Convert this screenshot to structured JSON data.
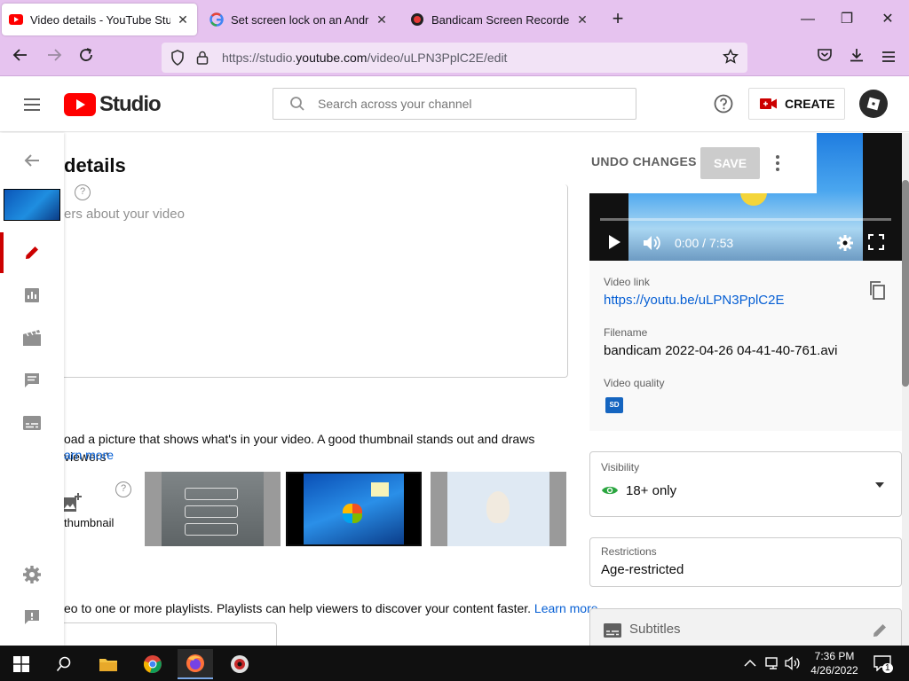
{
  "browser": {
    "tabs": [
      {
        "title": "Video details - YouTube Studio",
        "active": true
      },
      {
        "title": "Set screen lock on an Android d",
        "active": false
      },
      {
        "title": "Bandicam Screen Recorder Dow",
        "active": false
      }
    ],
    "url_prefix": "https://studio.",
    "url_domain": "youtube.com",
    "url_path": "/video/uLPN3PplC2E/edit"
  },
  "studio": {
    "logo_text": "Studio",
    "search_placeholder": "Search across your channel",
    "create_label": "CREATE"
  },
  "editor": {
    "page_title": "details",
    "undo_label": "UNDO CHANGES",
    "save_label": "SAVE",
    "description_placeholder": "ers about your video",
    "thumbnail_text": "oad a picture that shows what's in your video. A good thumbnail stands out and draws viewers'",
    "thumbnail_learn_more": "arn more",
    "upload_label": "thumbnail",
    "playlist_text": "eo to one or more playlists. Playlists can help viewers to discover your content faster.",
    "playlist_learn_more": "Learn more"
  },
  "video_panel": {
    "time": "0:00 / 7:53",
    "video_link_label": "Video link",
    "video_link": "https://youtu.be/uLPN3PplC2E",
    "filename_label": "Filename",
    "filename": "bandicam 2022-04-26 04-41-40-761.avi",
    "quality_label": "Video quality",
    "quality_badge": "SD"
  },
  "visibility": {
    "label": "Visibility",
    "value": "18+ only"
  },
  "restrictions": {
    "label": "Restrictions",
    "value": "Age-restricted"
  },
  "subtitles": {
    "label": "Subtitles"
  },
  "taskbar": {
    "time": "7:36 PM",
    "date": "4/26/2022",
    "notification_count": "1"
  },
  "colors": {
    "browser_chrome": "#e6c3ef",
    "yt_red": "#ff0000",
    "link_blue": "#065fd4",
    "active_red": "#cc0000"
  }
}
